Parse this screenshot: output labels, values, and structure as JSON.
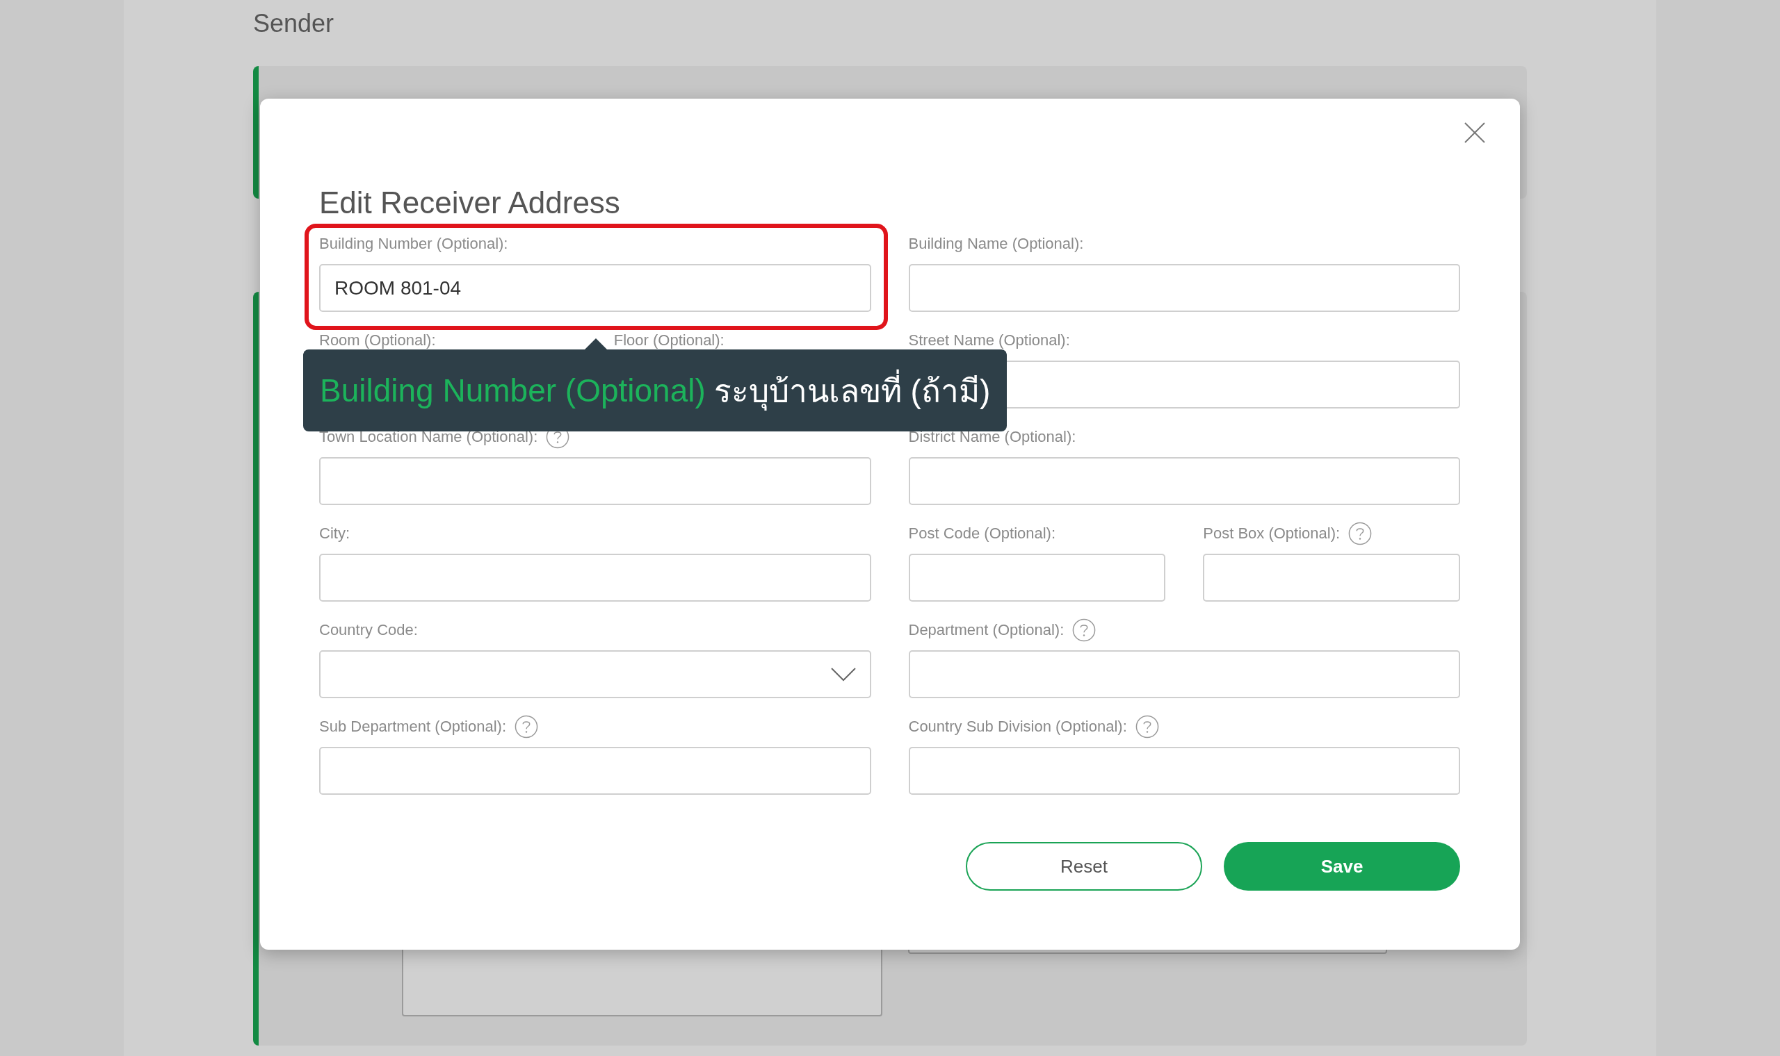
{
  "page": {
    "section_title": "Sender"
  },
  "modal": {
    "title": "Edit Receiver Address",
    "rows": [
      {
        "left": [
          {
            "label": "Building Number (Optional):",
            "kind": "text",
            "help": false,
            "value": "ROOM 801-04"
          }
        ],
        "right": [
          {
            "label": "Building Name (Optional):",
            "kind": "text",
            "help": false
          }
        ]
      },
      {
        "left": [
          {
            "label": "Room (Optional):",
            "kind": "covered",
            "help": false
          },
          {
            "label": "Floor (Optional):",
            "kind": "covered",
            "help": false
          }
        ],
        "right": [
          {
            "label": "Street Name (Optional):",
            "kind": "text",
            "help": false
          }
        ]
      },
      {
        "left": [
          {
            "label": "Town Location Name (Optional):",
            "kind": "text",
            "help": true
          }
        ],
        "right": [
          {
            "label": "District Name (Optional):",
            "kind": "text",
            "help": false
          }
        ]
      },
      {
        "left": [
          {
            "label": "City:",
            "kind": "text",
            "help": false
          }
        ],
        "right": [
          {
            "label": "Post Code (Optional):",
            "kind": "text",
            "help": false
          },
          {
            "label": "Post Box (Optional):",
            "kind": "text",
            "help": true
          }
        ]
      },
      {
        "left": [
          {
            "label": "Country Code:",
            "kind": "select",
            "help": false
          }
        ],
        "right": [
          {
            "label": "Department (Optional):",
            "kind": "text",
            "help": true
          }
        ]
      },
      {
        "left": [
          {
            "label": "Sub Department (Optional):",
            "kind": "text",
            "help": true
          }
        ],
        "right": [
          {
            "label": "Country Sub Division (Optional):",
            "kind": "text",
            "help": true
          }
        ]
      }
    ],
    "buttons": [
      {
        "label": "Reset",
        "kind": "secondary"
      },
      {
        "label": "Save",
        "kind": "primary"
      }
    ],
    "tooltip": {
      "term": "Building Number (Optional)",
      "text": "ระบุบ้านเลขที่ (ถ้ามี)"
    }
  }
}
